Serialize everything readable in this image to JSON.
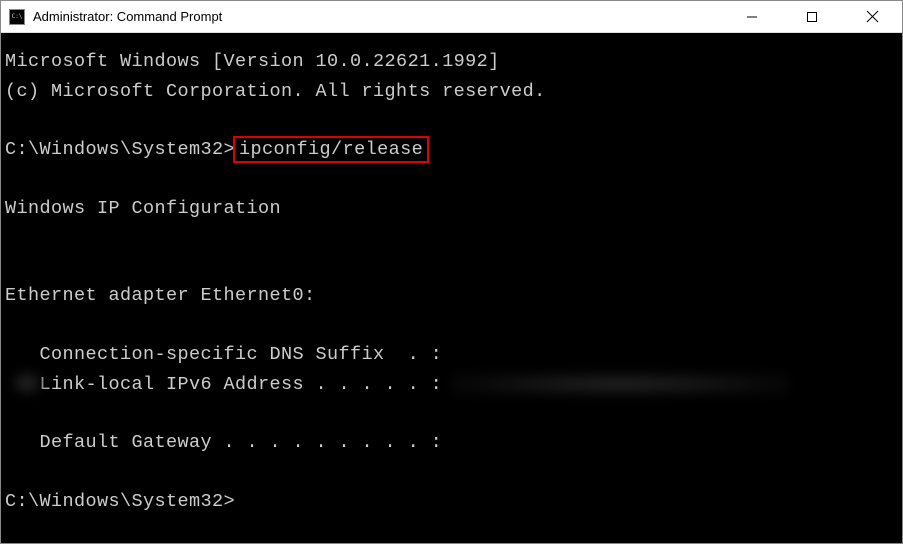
{
  "window": {
    "title": "Administrator: Command Prompt"
  },
  "terminal": {
    "banner_line1": "Microsoft Windows [Version 10.0.22621.1992]",
    "banner_line2": "(c) Microsoft Corporation. All rights reserved.",
    "prompt1_path": "C:\\Windows\\System32>",
    "command1": "ipconfig/release",
    "section_header": "Windows IP Configuration",
    "adapter_header": "Ethernet adapter Ethernet0:",
    "dns_suffix_label": "   Connection-specific DNS Suffix  . :",
    "ipv6_label": "   Link-local IPv6 Address . . . . . :",
    "gateway_label": "   Default Gateway . . . . . . . . . :",
    "prompt2_path": "C:\\Windows\\System32>"
  }
}
